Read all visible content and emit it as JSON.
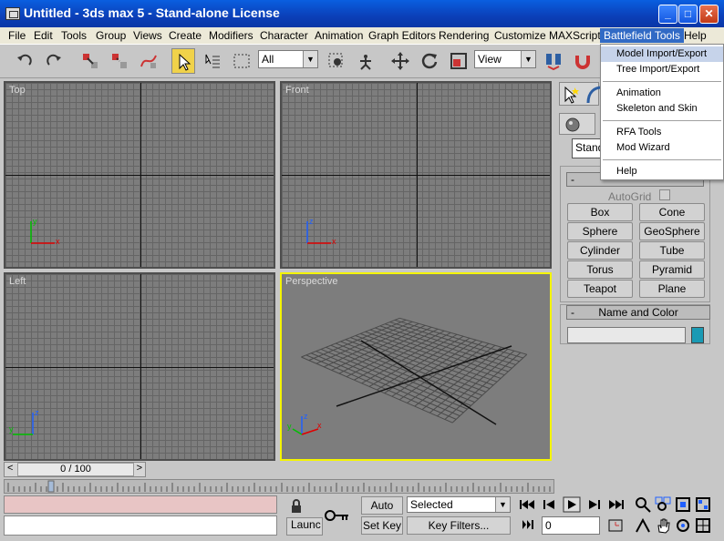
{
  "window": {
    "title": "Untitled - 3ds max 5 - Stand-alone License",
    "min": "_",
    "max": "□",
    "close": "✕"
  },
  "menu": [
    "File",
    "Edit",
    "Tools",
    "Group",
    "Views",
    "Create",
    "Modifiers",
    "Character",
    "Animation",
    "Graph Editors",
    "Rendering",
    "Customize",
    "MAXScript",
    "Battlefield Tools",
    "Help"
  ],
  "toolbar": {
    "selection_filter": "All",
    "ref_coord": "View"
  },
  "viewports": {
    "top": "Top",
    "front": "Front",
    "left": "Left",
    "perspective": "Perspective"
  },
  "axes": {
    "x": "x",
    "y": "y",
    "z": "z"
  },
  "dropdown": {
    "items": [
      "Model Import/Export",
      "Tree Import/Export",
      "Animation",
      "Skeleton and Skin",
      "RFA Tools",
      "Mod Wizard",
      "Help"
    ],
    "highlighted": "Model Import/Export"
  },
  "command_panel": {
    "object_type_dropdown": "Stand",
    "rollout_minus": "-",
    "autogrid_label": "AutoGrid",
    "buttons": [
      "Box",
      "Cone",
      "Sphere",
      "GeoSphere",
      "Cylinder",
      "Tube",
      "Torus",
      "Pyramid",
      "Teapot",
      "Plane"
    ],
    "name_color_title": "Name and Color",
    "color": "#1a9ab4"
  },
  "timeline": {
    "frame_display": "0 / 100",
    "prev": "<",
    "next": ">"
  },
  "bottom": {
    "auto_key": "Auto Key",
    "set_key": "Set Key",
    "selected": "Selected",
    "key_filters": "Key Filters...",
    "launch": "Launc",
    "frame_value": "0"
  }
}
